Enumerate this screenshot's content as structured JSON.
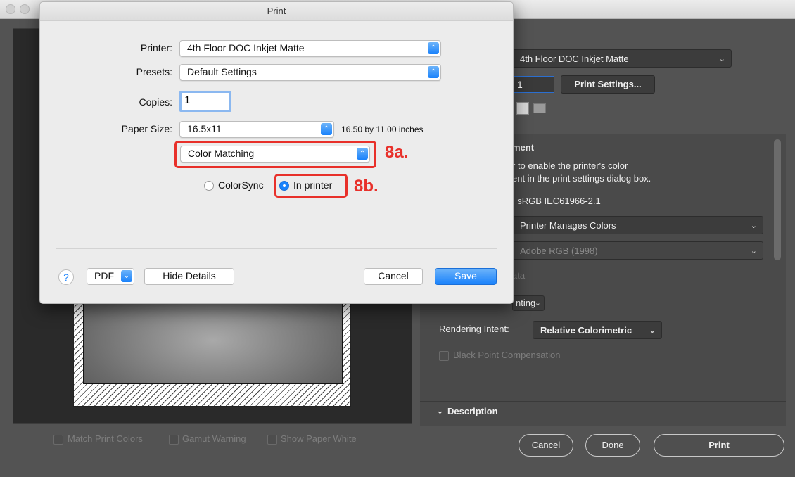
{
  "dialog": {
    "title": "Print",
    "printer_label": "Printer:",
    "printer_value": "4th Floor DOC Inkjet Matte",
    "presets_label": "Presets:",
    "presets_value": "Default Settings",
    "copies_label": "Copies:",
    "copies_value": "1",
    "paper_size_label": "Paper Size:",
    "paper_size_value": "16.5x11",
    "paper_size_dims": "16.50 by 11.00 inches",
    "section_value": "Color Matching",
    "radio_colorsync": "ColorSync",
    "radio_in_printer": "In printer",
    "radio_selected": "In printer",
    "help_label": "?",
    "pdf_label": "PDF",
    "hide_details_label": "Hide Details",
    "cancel_label": "Cancel",
    "save_label": "Save"
  },
  "annotations": {
    "step_a": "8a.",
    "step_b": "8b.",
    "highlight_color": "#e8302a"
  },
  "photoshop": {
    "printer_value": "4th Floor DOC Inkjet Matte",
    "copies_value": "1",
    "print_settings_label": "Print Settings...",
    "color_section_title_partial": "ment",
    "note_line1": "r to enable the printer's color",
    "note_line2": "ent in the print settings dialog box.",
    "profile_partial": ": sRGB IEC61966-2.1",
    "color_handling_value": "Printer Manages Colors",
    "printer_profile_value": "Adobe RGB (1998)",
    "data_partial": "ata",
    "printing_mode_partial": "nting",
    "rendering_intent_label": "Rendering Intent:",
    "rendering_intent_value": "Relative Colorimetric",
    "black_point_label": "Black Point Compensation",
    "description_label": "Description",
    "match_print_colors": "Match Print Colors",
    "gamut_warning": "Gamut Warning",
    "show_paper_white": "Show Paper White",
    "cancel_label": "Cancel",
    "done_label": "Done",
    "print_label": "Print"
  },
  "colors": {
    "accent_blue": "#1a82fb",
    "ps_background": "#535353"
  }
}
